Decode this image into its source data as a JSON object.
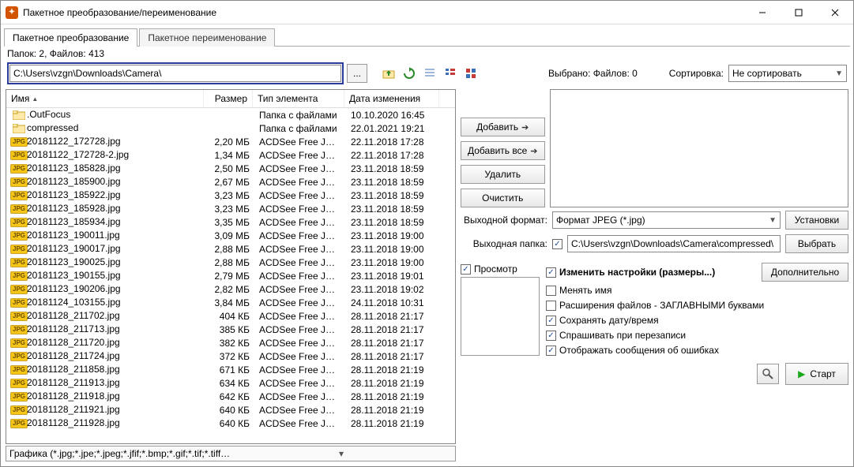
{
  "window": {
    "title": "Пакетное преобразование/переименование"
  },
  "tabs": {
    "convert": "Пакетное преобразование",
    "rename": "Пакетное переименование"
  },
  "status": "Папок: 2, Файлов: 413",
  "path": "C:\\Users\\vzgn\\Downloads\\Camera\\",
  "browse_btn": "...",
  "columns": {
    "name": "Имя",
    "size": "Размер",
    "type": "Тип элемента",
    "date": "Дата изменения"
  },
  "folder_type": "Папка с файлами",
  "jpeg_type": "ACDSee Free JPEG ...",
  "files": [
    {
      "icon": "folder",
      "name": ".OutFocus",
      "size": "",
      "type": "Папка с файлами",
      "date": "10.10.2020 16:45"
    },
    {
      "icon": "folder",
      "name": "compressed",
      "size": "",
      "type": "Папка с файлами",
      "date": "22.01.2021 19:21"
    },
    {
      "icon": "jpg",
      "name": "20181122_172728.jpg",
      "size": "2,20 МБ",
      "type": "ACDSee Free JPEG ...",
      "date": "22.11.2018 17:28"
    },
    {
      "icon": "jpg",
      "name": "20181122_172728-2.jpg",
      "size": "1,34 МБ",
      "type": "ACDSee Free JPEG ...",
      "date": "22.11.2018 17:28"
    },
    {
      "icon": "jpg",
      "name": "20181123_185828.jpg",
      "size": "2,50 МБ",
      "type": "ACDSee Free JPEG ...",
      "date": "23.11.2018 18:59"
    },
    {
      "icon": "jpg",
      "name": "20181123_185900.jpg",
      "size": "2,67 МБ",
      "type": "ACDSee Free JPEG ...",
      "date": "23.11.2018 18:59"
    },
    {
      "icon": "jpg",
      "name": "20181123_185922.jpg",
      "size": "3,23 МБ",
      "type": "ACDSee Free JPEG ...",
      "date": "23.11.2018 18:59"
    },
    {
      "icon": "jpg",
      "name": "20181123_185928.jpg",
      "size": "3,23 МБ",
      "type": "ACDSee Free JPEG ...",
      "date": "23.11.2018 18:59"
    },
    {
      "icon": "jpg",
      "name": "20181123_185934.jpg",
      "size": "3,35 МБ",
      "type": "ACDSee Free JPEG ...",
      "date": "23.11.2018 18:59"
    },
    {
      "icon": "jpg",
      "name": "20181123_190011.jpg",
      "size": "3,09 МБ",
      "type": "ACDSee Free JPEG ...",
      "date": "23.11.2018 19:00"
    },
    {
      "icon": "jpg",
      "name": "20181123_190017.jpg",
      "size": "2,88 МБ",
      "type": "ACDSee Free JPEG ...",
      "date": "23.11.2018 19:00"
    },
    {
      "icon": "jpg",
      "name": "20181123_190025.jpg",
      "size": "2,88 МБ",
      "type": "ACDSee Free JPEG ...",
      "date": "23.11.2018 19:00"
    },
    {
      "icon": "jpg",
      "name": "20181123_190155.jpg",
      "size": "2,79 МБ",
      "type": "ACDSee Free JPEG ...",
      "date": "23.11.2018 19:01"
    },
    {
      "icon": "jpg",
      "name": "20181123_190206.jpg",
      "size": "2,82 МБ",
      "type": "ACDSee Free JPEG ...",
      "date": "23.11.2018 19:02"
    },
    {
      "icon": "jpg",
      "name": "20181124_103155.jpg",
      "size": "3,84 МБ",
      "type": "ACDSee Free JPEG ...",
      "date": "24.11.2018 10:31"
    },
    {
      "icon": "jpg",
      "name": "20181128_211702.jpg",
      "size": "404 КБ",
      "type": "ACDSee Free JPEG ...",
      "date": "28.11.2018 21:17"
    },
    {
      "icon": "jpg",
      "name": "20181128_211713.jpg",
      "size": "385 КБ",
      "type": "ACDSee Free JPEG ...",
      "date": "28.11.2018 21:17"
    },
    {
      "icon": "jpg",
      "name": "20181128_211720.jpg",
      "size": "382 КБ",
      "type": "ACDSee Free JPEG ...",
      "date": "28.11.2018 21:17"
    },
    {
      "icon": "jpg",
      "name": "20181128_211724.jpg",
      "size": "372 КБ",
      "type": "ACDSee Free JPEG ...",
      "date": "28.11.2018 21:17"
    },
    {
      "icon": "jpg",
      "name": "20181128_211858.jpg",
      "size": "671 КБ",
      "type": "ACDSee Free JPEG ...",
      "date": "28.11.2018 21:19"
    },
    {
      "icon": "jpg",
      "name": "20181128_211913.jpg",
      "size": "634 КБ",
      "type": "ACDSee Free JPEG ...",
      "date": "28.11.2018 21:19"
    },
    {
      "icon": "jpg",
      "name": "20181128_211918.jpg",
      "size": "642 КБ",
      "type": "ACDSee Free JPEG ...",
      "date": "28.11.2018 21:19"
    },
    {
      "icon": "jpg",
      "name": "20181128_211921.jpg",
      "size": "640 КБ",
      "type": "ACDSee Free JPEG ...",
      "date": "28.11.2018 21:19"
    },
    {
      "icon": "jpg",
      "name": "20181128_211928.jpg",
      "size": "640 КБ",
      "type": "ACDSee Free JPEG ...",
      "date": "28.11.2018 21:19"
    }
  ],
  "filter": "Графика (*.jpg;*.jpe;*.jpeg;*.jfif;*.bmp;*.gif;*.tif;*.tiff;*.fax;*.cur;*.ico;*.png;*.pcx;*.webp;*.heic;*.heif;*",
  "actions": {
    "add": "Добавить",
    "addall": "Добавить все",
    "remove": "Удалить",
    "clear": "Очистить"
  },
  "selection": {
    "label": "Выбрано:",
    "count": "Файлов: 0"
  },
  "sort": {
    "label": "Сортировка:",
    "value": "Не сортировать"
  },
  "out_format": {
    "label": "Выходной формат:",
    "value": "Формат JPEG (*.jpg)",
    "settings": "Установки"
  },
  "out_folder": {
    "label": "Выходная папка:",
    "value": "C:\\Users\\vzgn\\Downloads\\Camera\\compressed\\",
    "browse": "Выбрать"
  },
  "preview_label": "Просмотр",
  "opts": {
    "change": "Изменить настройки (размеры...)",
    "rename": "Менять имя",
    "upper": "Расширения файлов - ЗАГЛАВНЫМИ буквами",
    "keepdate": "Сохранять дату/время",
    "overwrite": "Спрашивать при перезаписи",
    "errors": "Отображать сообщения об ошибках",
    "more": "Дополнительно"
  },
  "start": "Старт"
}
